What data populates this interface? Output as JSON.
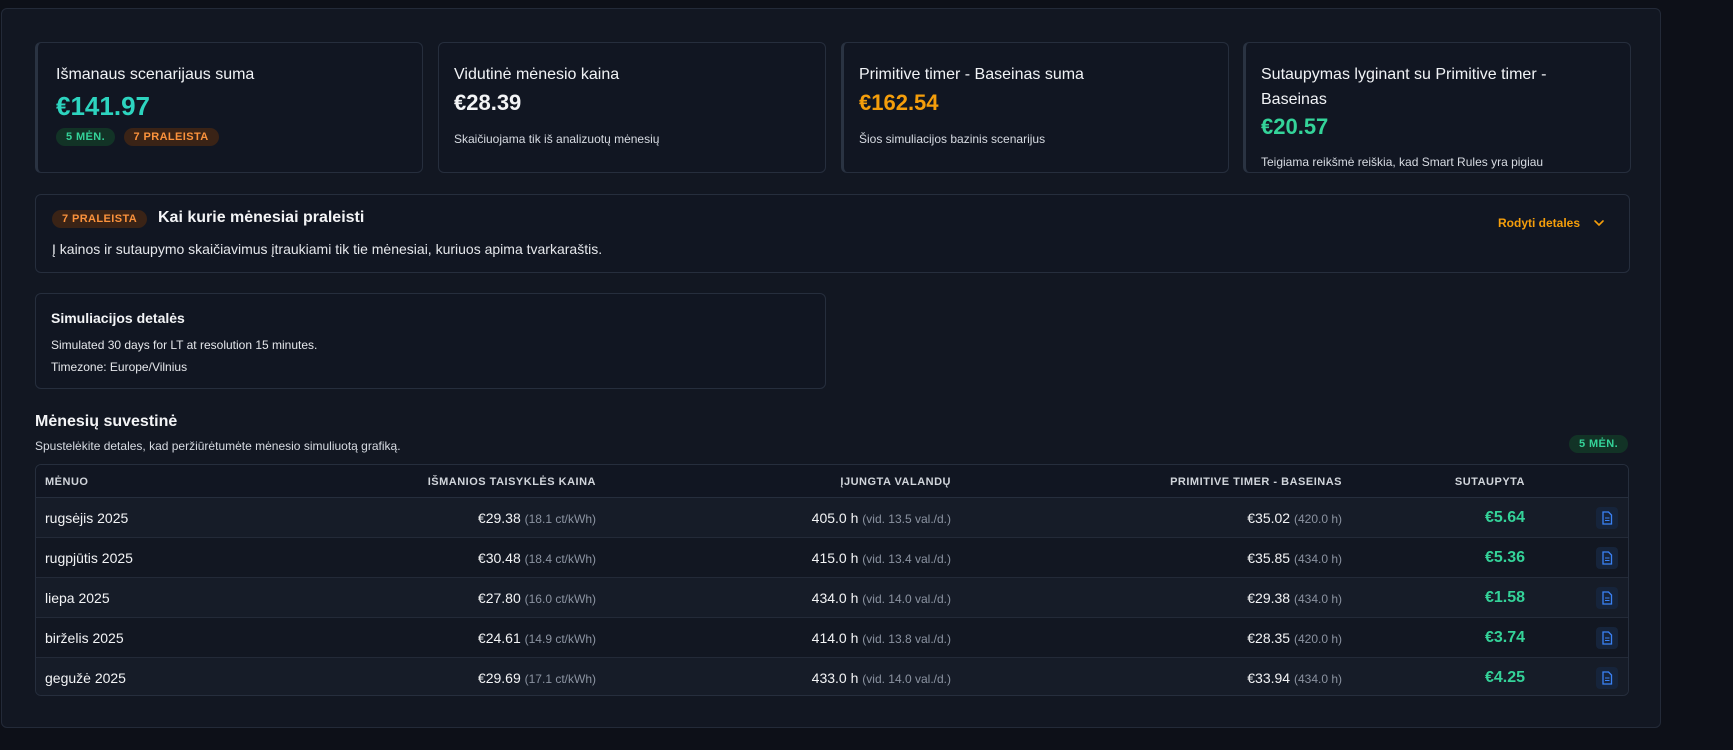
{
  "stats": [
    {
      "title": "Išmanaus scenarijaus suma",
      "value": "€141.97",
      "badges": [
        "5 MĖN.",
        "7 PRALEISTA"
      ]
    },
    {
      "title": "Vidutinė mėnesio kaina",
      "value": "€28.39",
      "note": "Skaičiuojama tik iš analizuotų mėnesių"
    },
    {
      "title": "Primitive timer - Baseinas suma",
      "value": "€162.54",
      "note": "Šios simuliacijos bazinis scenarijus"
    },
    {
      "title_line1": "Sutaupymas lyginant su Primitive timer -",
      "title_line2": "Baseinas",
      "value": "€20.57",
      "note": "Teigiama reikšmė reiškia, kad Smart Rules yra pigiau"
    }
  ],
  "skipped": {
    "badge": "7 PRALEISTA",
    "title": "Kai kurie mėnesiai praleisti",
    "text": "Į kainos ir sutaupymo skaičiavimus įtraukiami tik tie mėnesiai, kuriuos apima tvarkaraštis.",
    "toggle": "Rodyti detales"
  },
  "sim": {
    "title": "Simuliacijos detalės",
    "line1": "Simulated 30 days for LT at resolution 15 minutes.",
    "line2": "Timezone: Europe/Vilnius"
  },
  "summary": {
    "title": "Mėnesių suvestinė",
    "subtitle": "Spustelėkite detales, kad peržiūrėtumėte mėnesio simuliuotą grafiką.",
    "badge": "5 MĖN."
  },
  "table": {
    "headers": [
      "MĖNUO",
      "IŠMANIOS TAISYKLĖS KAINA",
      "ĮJUNGTA VALANDŲ",
      "PRIMITIVE TIMER - BASEINAS",
      "SUTAUPYTA"
    ],
    "rows": [
      {
        "month": "rugsėjis 2025",
        "price": "€29.38",
        "price_sub": "(18.1 ct/kWh)",
        "hours": "405.0 h",
        "hours_sub": "(vid. 13.5 val./d.)",
        "base": "€35.02",
        "base_sub": "(420.0 h)",
        "saved": "€5.64"
      },
      {
        "month": "rugpjūtis 2025",
        "price": "€30.48",
        "price_sub": "(18.4 ct/kWh)",
        "hours": "415.0 h",
        "hours_sub": "(vid. 13.4 val./d.)",
        "base": "€35.85",
        "base_sub": "(434.0 h)",
        "saved": "€5.36"
      },
      {
        "month": "liepa 2025",
        "price": "€27.80",
        "price_sub": "(16.0 ct/kWh)",
        "hours": "434.0 h",
        "hours_sub": "(vid. 14.0 val./d.)",
        "base": "€29.38",
        "base_sub": "(434.0 h)",
        "saved": "€1.58"
      },
      {
        "month": "birželis 2025",
        "price": "€24.61",
        "price_sub": "(14.9 ct/kWh)",
        "hours": "414.0 h",
        "hours_sub": "(vid. 13.8 val./d.)",
        "base": "€28.35",
        "base_sub": "(420.0 h)",
        "saved": "€3.74"
      },
      {
        "month": "gegužė 2025",
        "price": "€29.69",
        "price_sub": "(17.1 ct/kWh)",
        "hours": "433.0 h",
        "hours_sub": "(vid. 14.0 val./d.)",
        "base": "€33.94",
        "base_sub": "(434.0 h)",
        "saved": "€4.25"
      }
    ]
  },
  "colors": {
    "accent_teal": "#2dd4bf",
    "accent_orange": "#f59e0b",
    "savings_green": "#34d399"
  }
}
